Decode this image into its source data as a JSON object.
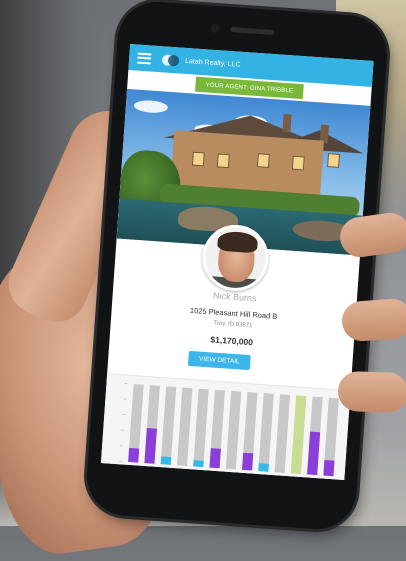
{
  "app": {
    "brand_name": "Latah Realty, LLC",
    "agent_banner": "YOUR AGENT: GINA TRIBBLE"
  },
  "listing": {
    "agent_name": "Nick Burns",
    "address": "1025 Pleasant Hill Road B",
    "city": "Troy, ID 83871",
    "price": "$1,170,000",
    "view_button": "VIEW DETAIL"
  },
  "colors": {
    "header": "#33b2e4",
    "agent_banner": "#7ab83a",
    "button": "#3cb6ea",
    "bar_gray": "#c8c8c8",
    "bar_purple": "#8a3fd9",
    "bar_cyan": "#37b9e8",
    "bar_green": "#c9dc92"
  },
  "chart_data": {
    "type": "bar",
    "ylim": [
      0,
      100
    ],
    "bars": [
      {
        "total": 100,
        "fill": 18,
        "fill_color": "purple"
      },
      {
        "total": 100,
        "fill": 45,
        "fill_color": "purple"
      },
      {
        "total": 100,
        "fill": 10,
        "fill_color": "cyan"
      },
      {
        "total": 100,
        "fill": 0,
        "fill_color": "none"
      },
      {
        "total": 100,
        "fill": 8,
        "fill_color": "cyan"
      },
      {
        "total": 100,
        "fill": 25,
        "fill_color": "purple"
      },
      {
        "total": 100,
        "fill": 0,
        "fill_color": "none"
      },
      {
        "total": 100,
        "fill": 22,
        "fill_color": "purple"
      },
      {
        "total": 100,
        "fill": 10,
        "fill_color": "cyan"
      },
      {
        "total": 100,
        "fill": 0,
        "fill_color": "none"
      },
      {
        "total": 100,
        "fill": 100,
        "fill_color": "green"
      },
      {
        "total": 100,
        "fill": 55,
        "fill_color": "purple"
      },
      {
        "total": 100,
        "fill": 20,
        "fill_color": "purple"
      }
    ]
  }
}
